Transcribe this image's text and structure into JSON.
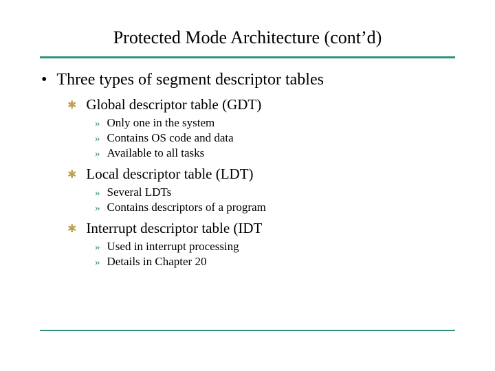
{
  "title": "Protected Mode Architecture (cont’d)",
  "bullets": {
    "dot": "•",
    "star": "✱",
    "arrow": "»"
  },
  "l1": {
    "text": "Three types of segment descriptor tables"
  },
  "l2_0": {
    "text": "Global descriptor table (GDT)"
  },
  "l2_0_sub": {
    "0": "Only one in the system",
    "1": "Contains OS code and data",
    "2": "Available to all tasks"
  },
  "l2_1": {
    "text": "Local descriptor table (LDT)"
  },
  "l2_1_sub": {
    "0": "Several LDTs",
    "1": "Contains descriptors of a program"
  },
  "l2_2": {
    "text": "Interrupt descriptor table (IDT"
  },
  "l2_2_sub": {
    "0": "Used in interrupt processing",
    "1": "Details in Chapter 20"
  }
}
